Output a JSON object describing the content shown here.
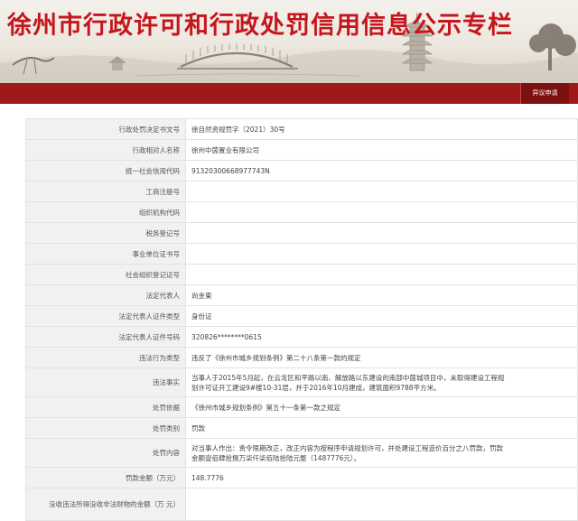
{
  "banner": {
    "title": "徐州市行政许可和行政处罚信用信息公示专栏"
  },
  "toolbar": {
    "objection_label": "异议申请"
  },
  "colors": {
    "accent": "#c4161c",
    "bar": "#9e1a1a",
    "button": "#7c1010"
  },
  "rows": [
    {
      "label": "行政处罚决定书文号",
      "value": "徐自然资规罚字（2021）30号"
    },
    {
      "label": "行政相对人名称",
      "value": "徐州中茵置业有限公司"
    },
    {
      "label": "统一社会信用代码",
      "value": "91320300668977743N"
    },
    {
      "label": "工商注册号",
      "value": ""
    },
    {
      "label": "组织机构代码",
      "value": ""
    },
    {
      "label": "税务登记号",
      "value": ""
    },
    {
      "label": "事业单位证书号",
      "value": ""
    },
    {
      "label": "社会组织登记证号",
      "value": ""
    },
    {
      "label": "法定代表人",
      "value": "尚金東"
    },
    {
      "label": "法定代表人证件类型",
      "value": "身份证"
    },
    {
      "label": "法定代表人证件号码",
      "value": "320826********0615"
    },
    {
      "label": "违法行为类型",
      "value": "违反了《徐州市城乡规划条例》第二十八条第一款的规定"
    },
    {
      "label": "违法事实",
      "value_lines": [
        "当事人于2015年5月起，在云龙区和平路以南、解放路以东建设的南部中茵城项目中，未取得建设工程规",
        "划许可证开工建设9#楼10-31层，并于2016年10月建成，建筑面积9788平方米。"
      ]
    },
    {
      "label": "处罚依据",
      "value": "《徐州市城乡规划条例》第五十一条第一款之规定"
    },
    {
      "label": "处罚类别",
      "value": "罚款"
    },
    {
      "label": "处罚内容",
      "value_lines": [
        "对当事人作出：责令限期改正，改正内容为按程序申请规划许可，并处建设工程造价百分之八罚款，罚款",
        "金额壹佰肆拾捌万柒仟柒佰陆拾陆元整（1487776元）。"
      ]
    },
    {
      "label": "罚款金额（万元）",
      "value": "148.7776"
    },
    {
      "label_lines": [
        "没收违法所得没收非法财物的金额（万",
        "元）"
      ],
      "value": ""
    }
  ]
}
